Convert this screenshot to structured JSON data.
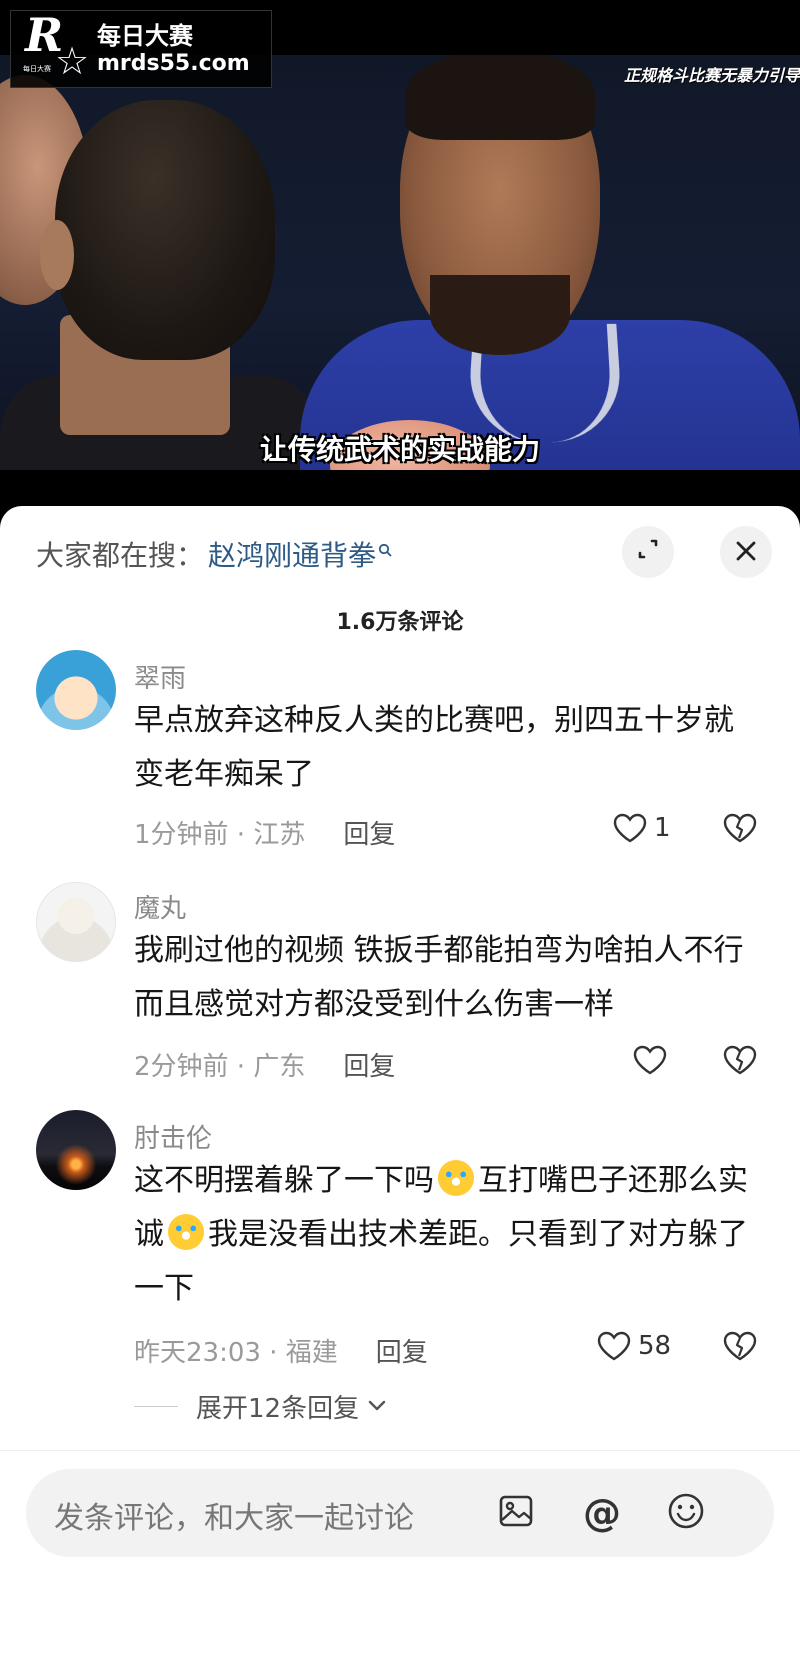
{
  "video": {
    "watermark_cn": "每日大赛",
    "watermark_url": "mrds55.com",
    "watermark_badge": "每日大赛",
    "top_caption": "正规格斗比赛无暴力引导",
    "subtitle": "让传统武术的实战能力"
  },
  "sheet": {
    "search_prefix": "大家都在搜：",
    "search_term": "赵鸿刚通背拳",
    "comment_count": "1.6万条评论",
    "expand_icon": "expand-icon",
    "close_icon": "close-icon"
  },
  "comments": [
    {
      "username": "翠雨",
      "text": "早点放弃这种反人类的比赛吧，别四五十岁就变老年痴呆了",
      "time_location": "1分钟前 · 江苏",
      "reply_label": "回复",
      "likes": "1"
    },
    {
      "username": "魔丸",
      "text": "我刷过他的视频 铁扳手都能拍弯为啥拍人不行 而且感觉对方都没受到什么伤害一样",
      "time_location": "2分钟前 · 广东",
      "reply_label": "回复",
      "likes": ""
    },
    {
      "username": "肘击伦",
      "text_part1": "这不明摆着躲了一下吗",
      "text_part2": "互打嘴巴子还那么实诚",
      "text_part3": "我是没看出技术差距。只看到了对方躲了一下",
      "time_location": "昨天23:03 · 福建",
      "reply_label": "回复",
      "likes": "58",
      "expand_replies": "展开12条回复"
    }
  ],
  "input_bar": {
    "placeholder": "发条评论，和大家一起讨论",
    "icons": [
      "image-icon",
      "at-icon",
      "emoji-icon"
    ]
  }
}
